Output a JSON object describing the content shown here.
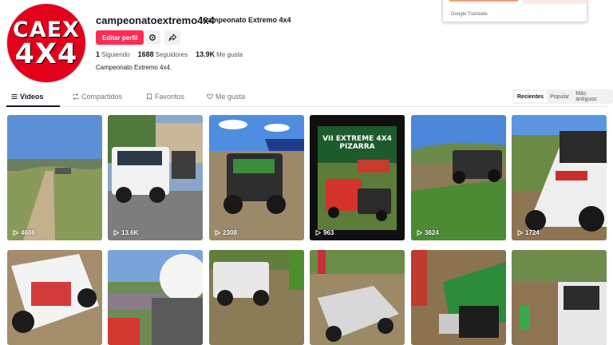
{
  "avatar": {
    "line1": "CAEX",
    "line2": "4X4"
  },
  "profile": {
    "username": "campeonatoextremo4x4",
    "nickname": "Campeonato Extremo 4x4",
    "edit_label": "Editar perfil",
    "bio": "Campeonato Extremo 4x4."
  },
  "stats": [
    {
      "value": "1",
      "label": "Siguiendo"
    },
    {
      "value": "1688",
      "label": "Seguidores"
    },
    {
      "value": "13.9K",
      "label": "Me gusta"
    }
  ],
  "translate": {
    "brand": "Google Translate"
  },
  "tabs": [
    {
      "label": "Videos"
    },
    {
      "label": "Compartidos"
    },
    {
      "label": "Favoritos"
    },
    {
      "label": "Me gusta"
    }
  ],
  "sort": [
    "Recientes",
    "Popular",
    "Más antiguos"
  ],
  "poster": {
    "title_line1": "VII EXTREME 4X4",
    "title_line2": "PIZARRA"
  },
  "videos": [
    {
      "views": "4606"
    },
    {
      "views": "13.6K"
    },
    {
      "views": "2308"
    },
    {
      "views": "963"
    },
    {
      "views": "3624"
    },
    {
      "views": "1724"
    }
  ],
  "colors": {
    "accent": "#fe2c55",
    "avatar_bg": "#e2001a"
  }
}
